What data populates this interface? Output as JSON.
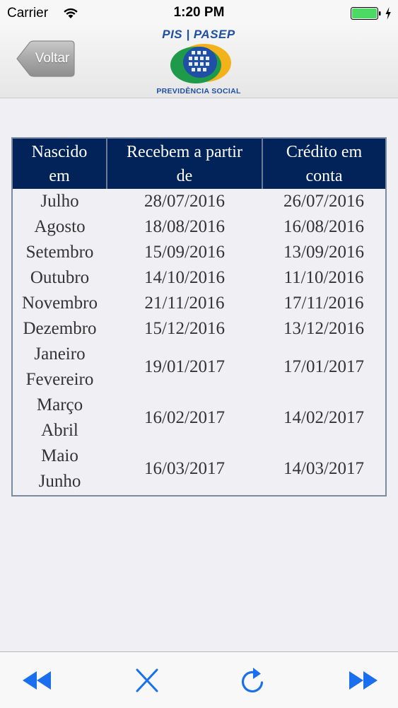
{
  "status_bar": {
    "carrier": "Carrier",
    "time": "1:20 PM",
    "wifi_icon": "wifi-icon",
    "battery_icon": "battery-icon",
    "battery_color": "#4cd964"
  },
  "nav": {
    "back_label": "Voltar",
    "logo_title": "PIS | PASEP",
    "logo_subtitle": "PREVIDÊNCIA SOCIAL",
    "brand_blue": "#1f4fa6",
    "brand_green": "#1e9a4a",
    "brand_yellow": "#f3b21a"
  },
  "table": {
    "header_bg": "#022359",
    "headers": [
      [
        "Nascido",
        "em"
      ],
      [
        "Recebem a partir",
        "de"
      ],
      [
        "Crédito em",
        "conta"
      ]
    ],
    "rows": [
      {
        "months": [
          "Julho"
        ],
        "recebem": "28/07/2016",
        "credito": "26/07/2016"
      },
      {
        "months": [
          "Agosto"
        ],
        "recebem": "18/08/2016",
        "credito": "16/08/2016"
      },
      {
        "months": [
          "Setembro"
        ],
        "recebem": "15/09/2016",
        "credito": "13/09/2016"
      },
      {
        "months": [
          "Outubro"
        ],
        "recebem": "14/10/2016",
        "credito": "11/10/2016"
      },
      {
        "months": [
          "Novembro"
        ],
        "recebem": "21/11/2016",
        "credito": "17/11/2016"
      },
      {
        "months": [
          "Dezembro"
        ],
        "recebem": "15/12/2016",
        "credito": "13/12/2016"
      },
      {
        "months": [
          "Janeiro",
          "Fevereiro"
        ],
        "recebem": "19/01/2017",
        "credito": "17/01/2017"
      },
      {
        "months": [
          "Março",
          "Abril"
        ],
        "recebem": "16/02/2017",
        "credito": "14/02/2017"
      },
      {
        "months": [
          "Maio",
          "Junho"
        ],
        "recebem": "16/03/2017",
        "credito": "14/03/2017"
      }
    ]
  },
  "toolbar": {
    "tint": "#1a6fef",
    "buttons": [
      "rewind-icon",
      "close-icon",
      "reload-icon",
      "fast-forward-icon"
    ]
  }
}
